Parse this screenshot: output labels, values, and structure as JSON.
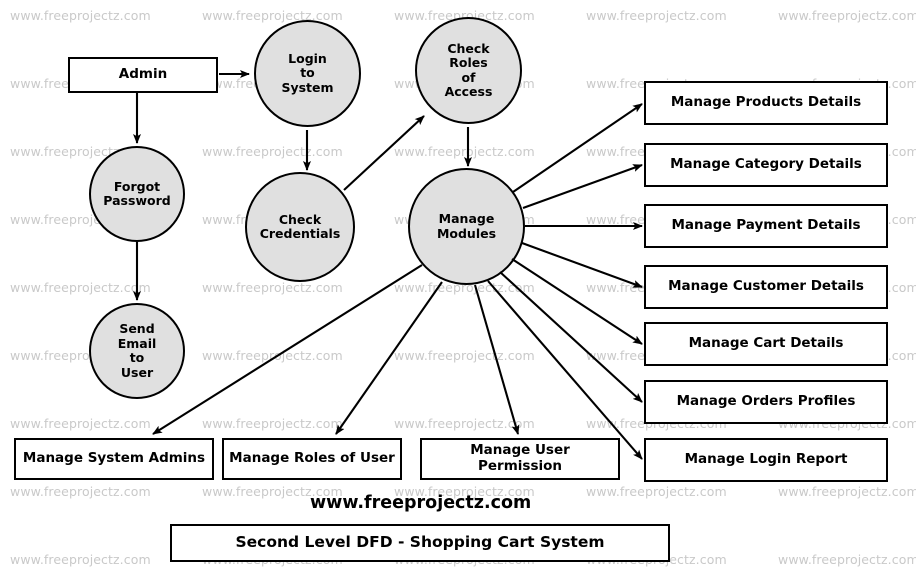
{
  "diagram": {
    "title": "Second Level DFD - Shopping Cart System",
    "credit": "www.freeprojectz.com",
    "watermark_text": "www.freeprojectz.com",
    "colors": {
      "process_fill": "#e0e0e0",
      "stroke": "#000000",
      "entity_fill": "#ffffff",
      "watermark": "#c9c9c9",
      "background": "#ffffff"
    }
  },
  "entities": [
    {
      "id": "admin",
      "label": "Admin"
    }
  ],
  "processes": [
    {
      "id": "login_to_system",
      "label": "Login\nto\nSystem"
    },
    {
      "id": "check_roles_of_access",
      "label": "Check\nRoles\nof\nAccess"
    },
    {
      "id": "forgot_password",
      "label": "Forgot\nPassword"
    },
    {
      "id": "check_credentials",
      "label": "Check\nCredentials"
    },
    {
      "id": "send_email_to_user",
      "label": "Send\nEmail\nto\nUser"
    },
    {
      "id": "manage_modules",
      "label": "Manage\nModules"
    }
  ],
  "right_datastores": [
    {
      "id": "manage_products_details",
      "label": "Manage Products Details"
    },
    {
      "id": "manage_category_details",
      "label": "Manage Category Details"
    },
    {
      "id": "manage_payment_details",
      "label": "Manage Payment Details"
    },
    {
      "id": "manage_customer_details",
      "label": "Manage Customer Details"
    },
    {
      "id": "manage_cart_details",
      "label": "Manage Cart Details"
    },
    {
      "id": "manage_orders_profiles",
      "label": "Manage Orders Profiles"
    },
    {
      "id": "manage_login_report",
      "label": "Manage Login Report"
    }
  ],
  "bottom_datastores": [
    {
      "id": "manage_system_admins",
      "label": "Manage System Admins"
    },
    {
      "id": "manage_roles_of_user",
      "label": "Manage Roles of User"
    },
    {
      "id": "manage_user_permission",
      "label": "Manage User Permission"
    }
  ],
  "flows": [
    {
      "from": "admin",
      "to": "login_to_system"
    },
    {
      "from": "admin",
      "to": "forgot_password"
    },
    {
      "from": "login_to_system",
      "to": "check_credentials"
    },
    {
      "from": "check_credentials",
      "to": "check_roles_of_access"
    },
    {
      "from": "check_roles_of_access",
      "to": "manage_modules"
    },
    {
      "from": "forgot_password",
      "to": "send_email_to_user"
    },
    {
      "from": "send_email_to_user",
      "to": "manage_system_admins"
    },
    {
      "from": "manage_modules",
      "to": "manage_products_details"
    },
    {
      "from": "manage_modules",
      "to": "manage_category_details"
    },
    {
      "from": "manage_modules",
      "to": "manage_payment_details"
    },
    {
      "from": "manage_modules",
      "to": "manage_customer_details"
    },
    {
      "from": "manage_modules",
      "to": "manage_cart_details"
    },
    {
      "from": "manage_modules",
      "to": "manage_orders_profiles"
    },
    {
      "from": "manage_modules",
      "to": "manage_login_report"
    },
    {
      "from": "manage_modules",
      "to": "manage_system_admins"
    },
    {
      "from": "manage_modules",
      "to": "manage_roles_of_user"
    },
    {
      "from": "manage_modules",
      "to": "manage_user_permission"
    }
  ]
}
